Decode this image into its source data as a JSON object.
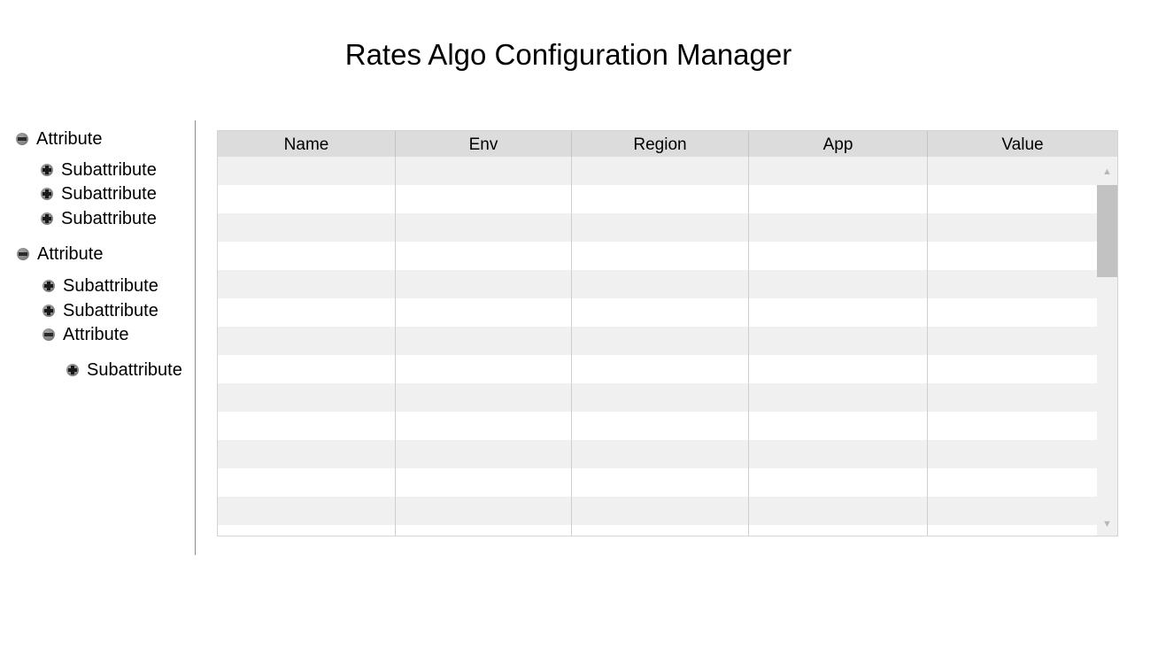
{
  "title": "Rates Algo Configuration Manager",
  "tree": [
    {
      "label": "Attribute",
      "state": "expanded",
      "icon": "minus-circle-icon"
    },
    {
      "label": "Subattribute",
      "state": "collapsed",
      "icon": "plus-circle-icon"
    },
    {
      "label": "Subattribute",
      "state": "collapsed",
      "icon": "plus-circle-icon"
    },
    {
      "label": "Subattribute",
      "state": "collapsed",
      "icon": "plus-circle-icon"
    },
    {
      "label": "Attribute",
      "state": "expanded",
      "icon": "minus-circle-icon"
    },
    {
      "label": "Subattribute",
      "state": "collapsed",
      "icon": "plus-circle-icon"
    },
    {
      "label": "Subattribute",
      "state": "collapsed",
      "icon": "plus-circle-icon"
    },
    {
      "label": "Attribute",
      "state": "expanded",
      "icon": "minus-circle-icon"
    },
    {
      "label": "Subattribute",
      "state": "collapsed",
      "icon": "plus-circle-icon"
    }
  ],
  "grid": {
    "columns": [
      "Name",
      "Env",
      "Region",
      "App",
      "Value"
    ],
    "rows": [
      [
        "",
        "",
        "",
        "",
        ""
      ],
      [
        "",
        "",
        "",
        "",
        ""
      ],
      [
        "",
        "",
        "",
        "",
        ""
      ],
      [
        "",
        "",
        "",
        "",
        ""
      ],
      [
        "",
        "",
        "",
        "",
        ""
      ],
      [
        "",
        "",
        "",
        "",
        ""
      ],
      [
        "",
        "",
        "",
        "",
        ""
      ],
      [
        "",
        "",
        "",
        "",
        ""
      ],
      [
        "",
        "",
        "",
        "",
        ""
      ],
      [
        "",
        "",
        "",
        "",
        ""
      ],
      [
        "",
        "",
        "",
        "",
        ""
      ],
      [
        "",
        "",
        "",
        "",
        ""
      ],
      [
        "",
        "",
        "",
        "",
        ""
      ],
      [
        "",
        "",
        "",
        "",
        ""
      ]
    ]
  },
  "scrollbar": {
    "up_icon": "▲",
    "down_icon": "▼"
  },
  "colors": {
    "header_bg": "#dcdcdc",
    "row_alt": "#f0f0f0",
    "row_white": "#ffffff",
    "scroll_thumb": "#c2c2c2",
    "tree_divider": "#8c8c8c"
  }
}
